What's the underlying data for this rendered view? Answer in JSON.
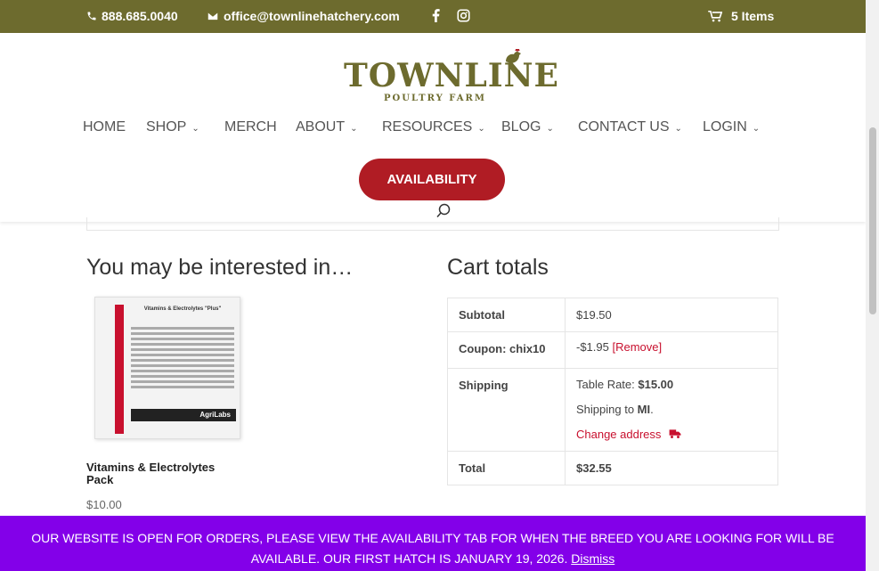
{
  "topbar": {
    "phone": "888.685.0040",
    "email": "office@townlinehatchery.com",
    "cart": "5 Items"
  },
  "logo": {
    "name": "TOWNLINE",
    "tagline": "POULTRY FARM"
  },
  "nav": {
    "items": [
      {
        "label": "HOME"
      },
      {
        "label": "SHOP"
      },
      {
        "label": "MERCH"
      },
      {
        "label": "ABOUT"
      },
      {
        "label": "RESOURCES"
      },
      {
        "label": "BLOG"
      },
      {
        "label": "CONTACT US"
      },
      {
        "label": "LOGIN"
      }
    ],
    "availability": "AVAILABILITY"
  },
  "interested": {
    "heading": "You may be interested in…",
    "product": {
      "name": "Vitamins & Electrolytes Pack",
      "price": "$10.00",
      "package_title": "Vitamins & Electrolytes \"Plus\"",
      "package_brand": "AgriLabs"
    }
  },
  "cart_totals": {
    "heading": "Cart totals",
    "subtotal_label": "Subtotal",
    "subtotal_value": "$19.50",
    "coupon_label": "Coupon: chix10",
    "coupon_value": "-$1.95",
    "coupon_remove": "[Remove]",
    "shipping_label": "Shipping",
    "shipping_rate_prefix": "Table Rate: ",
    "shipping_rate": "$15.00",
    "shipping_to_prefix": "Shipping to ",
    "shipping_to": "MI",
    "shipping_to_suffix": ".",
    "change_address": "Change address",
    "total_label": "Total",
    "total_value": "$32.55"
  },
  "banner": {
    "text": "Our website is open for orders, please view the availability tab for when the breed you are looking for will be available. Our first hatch is January 19, 2026.",
    "dismiss": "Dismiss"
  },
  "colors": {
    "topbar": "#6d6b2e",
    "accent_red": "#b01c24",
    "banner": "#8300e9"
  }
}
